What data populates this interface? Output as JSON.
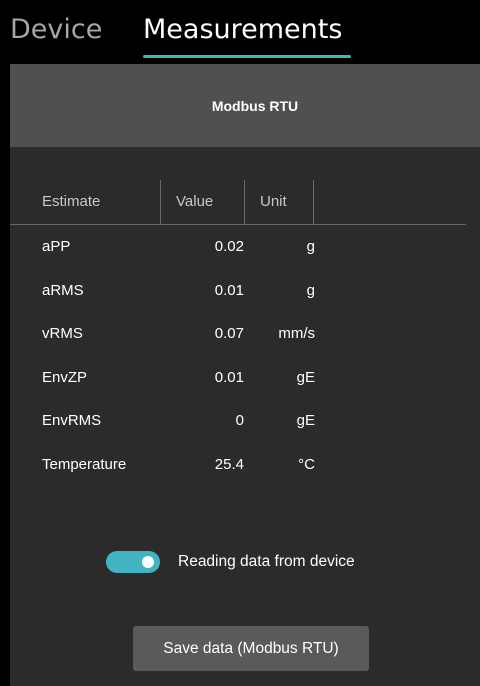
{
  "tabs": [
    {
      "label": "Device",
      "active": false
    },
    {
      "label": "Measurements",
      "active": true
    }
  ],
  "colors": {
    "accent": "#40b4c0",
    "panel_bg": "#2b2b2b",
    "header_bg": "#505050",
    "button_bg": "#5a5a5a",
    "window_bg": "#000000"
  },
  "panel": {
    "title": "Modbus RTU"
  },
  "table": {
    "headers": {
      "estimate": "Estimate",
      "value": "Value",
      "unit": "Unit"
    },
    "rows": [
      {
        "estimate": "aPP",
        "value": "0.02",
        "unit": "g"
      },
      {
        "estimate": "aRMS",
        "value": "0.01",
        "unit": "g"
      },
      {
        "estimate": "vRMS",
        "value": "0.07",
        "unit": "mm/s"
      },
      {
        "estimate": "EnvZP",
        "value": "0.01",
        "unit": "gE"
      },
      {
        "estimate": "EnvRMS",
        "value": "0",
        "unit": "gE"
      },
      {
        "estimate": "Temperature",
        "value": "25.4",
        "unit": "°C"
      }
    ]
  },
  "toggle": {
    "label": "Reading data from device",
    "on": true
  },
  "save_button": {
    "label": "Save data (Modbus RTU)"
  }
}
